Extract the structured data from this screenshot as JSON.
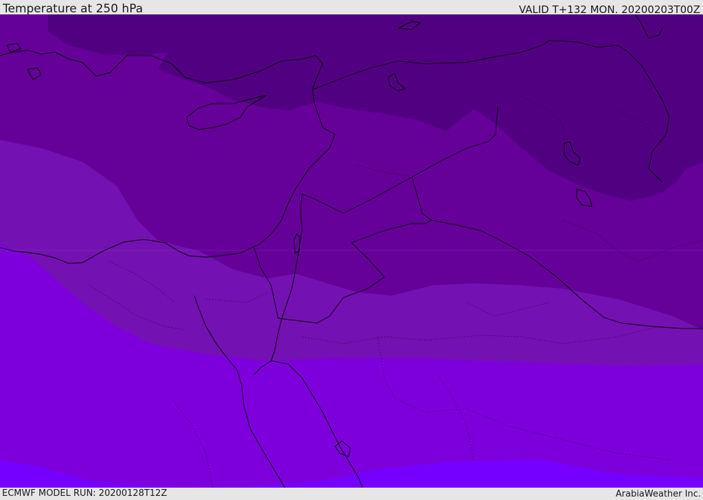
{
  "header": {
    "title": "Temperature at 250 hPa",
    "valid": "VALID T+132 MON. 20200203T00Z"
  },
  "footer": {
    "model_run": "ECMWF MODEL RUN: 20200128T12Z",
    "credit": "ArabiaWeather Inc."
  },
  "map": {
    "colors": {
      "band_coldest": "#520082",
      "band_cold": "#650098",
      "band_mid": "#7411b2",
      "band_warm": "#7d00dc",
      "band_warmest": "#7600ff",
      "coastline": "#000000"
    }
  }
}
